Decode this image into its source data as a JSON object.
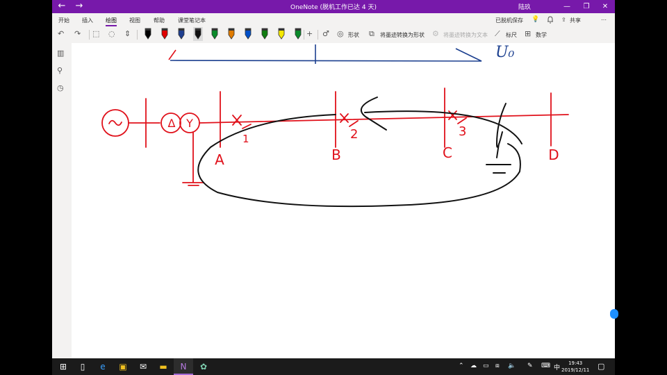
{
  "titlebar": {
    "back": "←",
    "forward": "→",
    "title": "OneNote (脱机工作已达 4 天)",
    "user": "陆玖",
    "minimize": "—",
    "restore": "❐",
    "close": "✕"
  },
  "tabs": [
    {
      "label": "开始"
    },
    {
      "label": "插入"
    },
    {
      "label": "绘图"
    },
    {
      "label": "视图"
    },
    {
      "label": "帮助"
    },
    {
      "label": "课堂笔记本"
    }
  ],
  "status_right": {
    "saved": "已脱机保存",
    "share": "共享"
  },
  "ribbon": {
    "shapes": "形状",
    "ink_to_shape": "将墨迹转换为形状",
    "ink_to_text": "将墨迹转换为文本",
    "ruler": "标尺",
    "math": "数学"
  },
  "pen_colors": [
    "#000000",
    "#e00000",
    "#1f3f8f",
    "#111111",
    "#0a8a2a",
    "#e07b00",
    "#0050c8",
    "#107c10",
    "#f5e800",
    "#0a8a2a"
  ],
  "drawing": {
    "stroke_red": "#e0101a",
    "stroke_black": "#111111",
    "stroke_blue": "#1b3f8f",
    "label_u0": "U₀",
    "bus_labels": [
      "A",
      "B",
      "C",
      "D"
    ],
    "point_labels": [
      "1",
      "2",
      "3"
    ],
    "source_symbol": "~",
    "delta_symbol": "Δ",
    "wye_symbol": "Y"
  },
  "taskbar": {
    "ime": "中",
    "time": "19:43",
    "date": "2019/12/11"
  }
}
